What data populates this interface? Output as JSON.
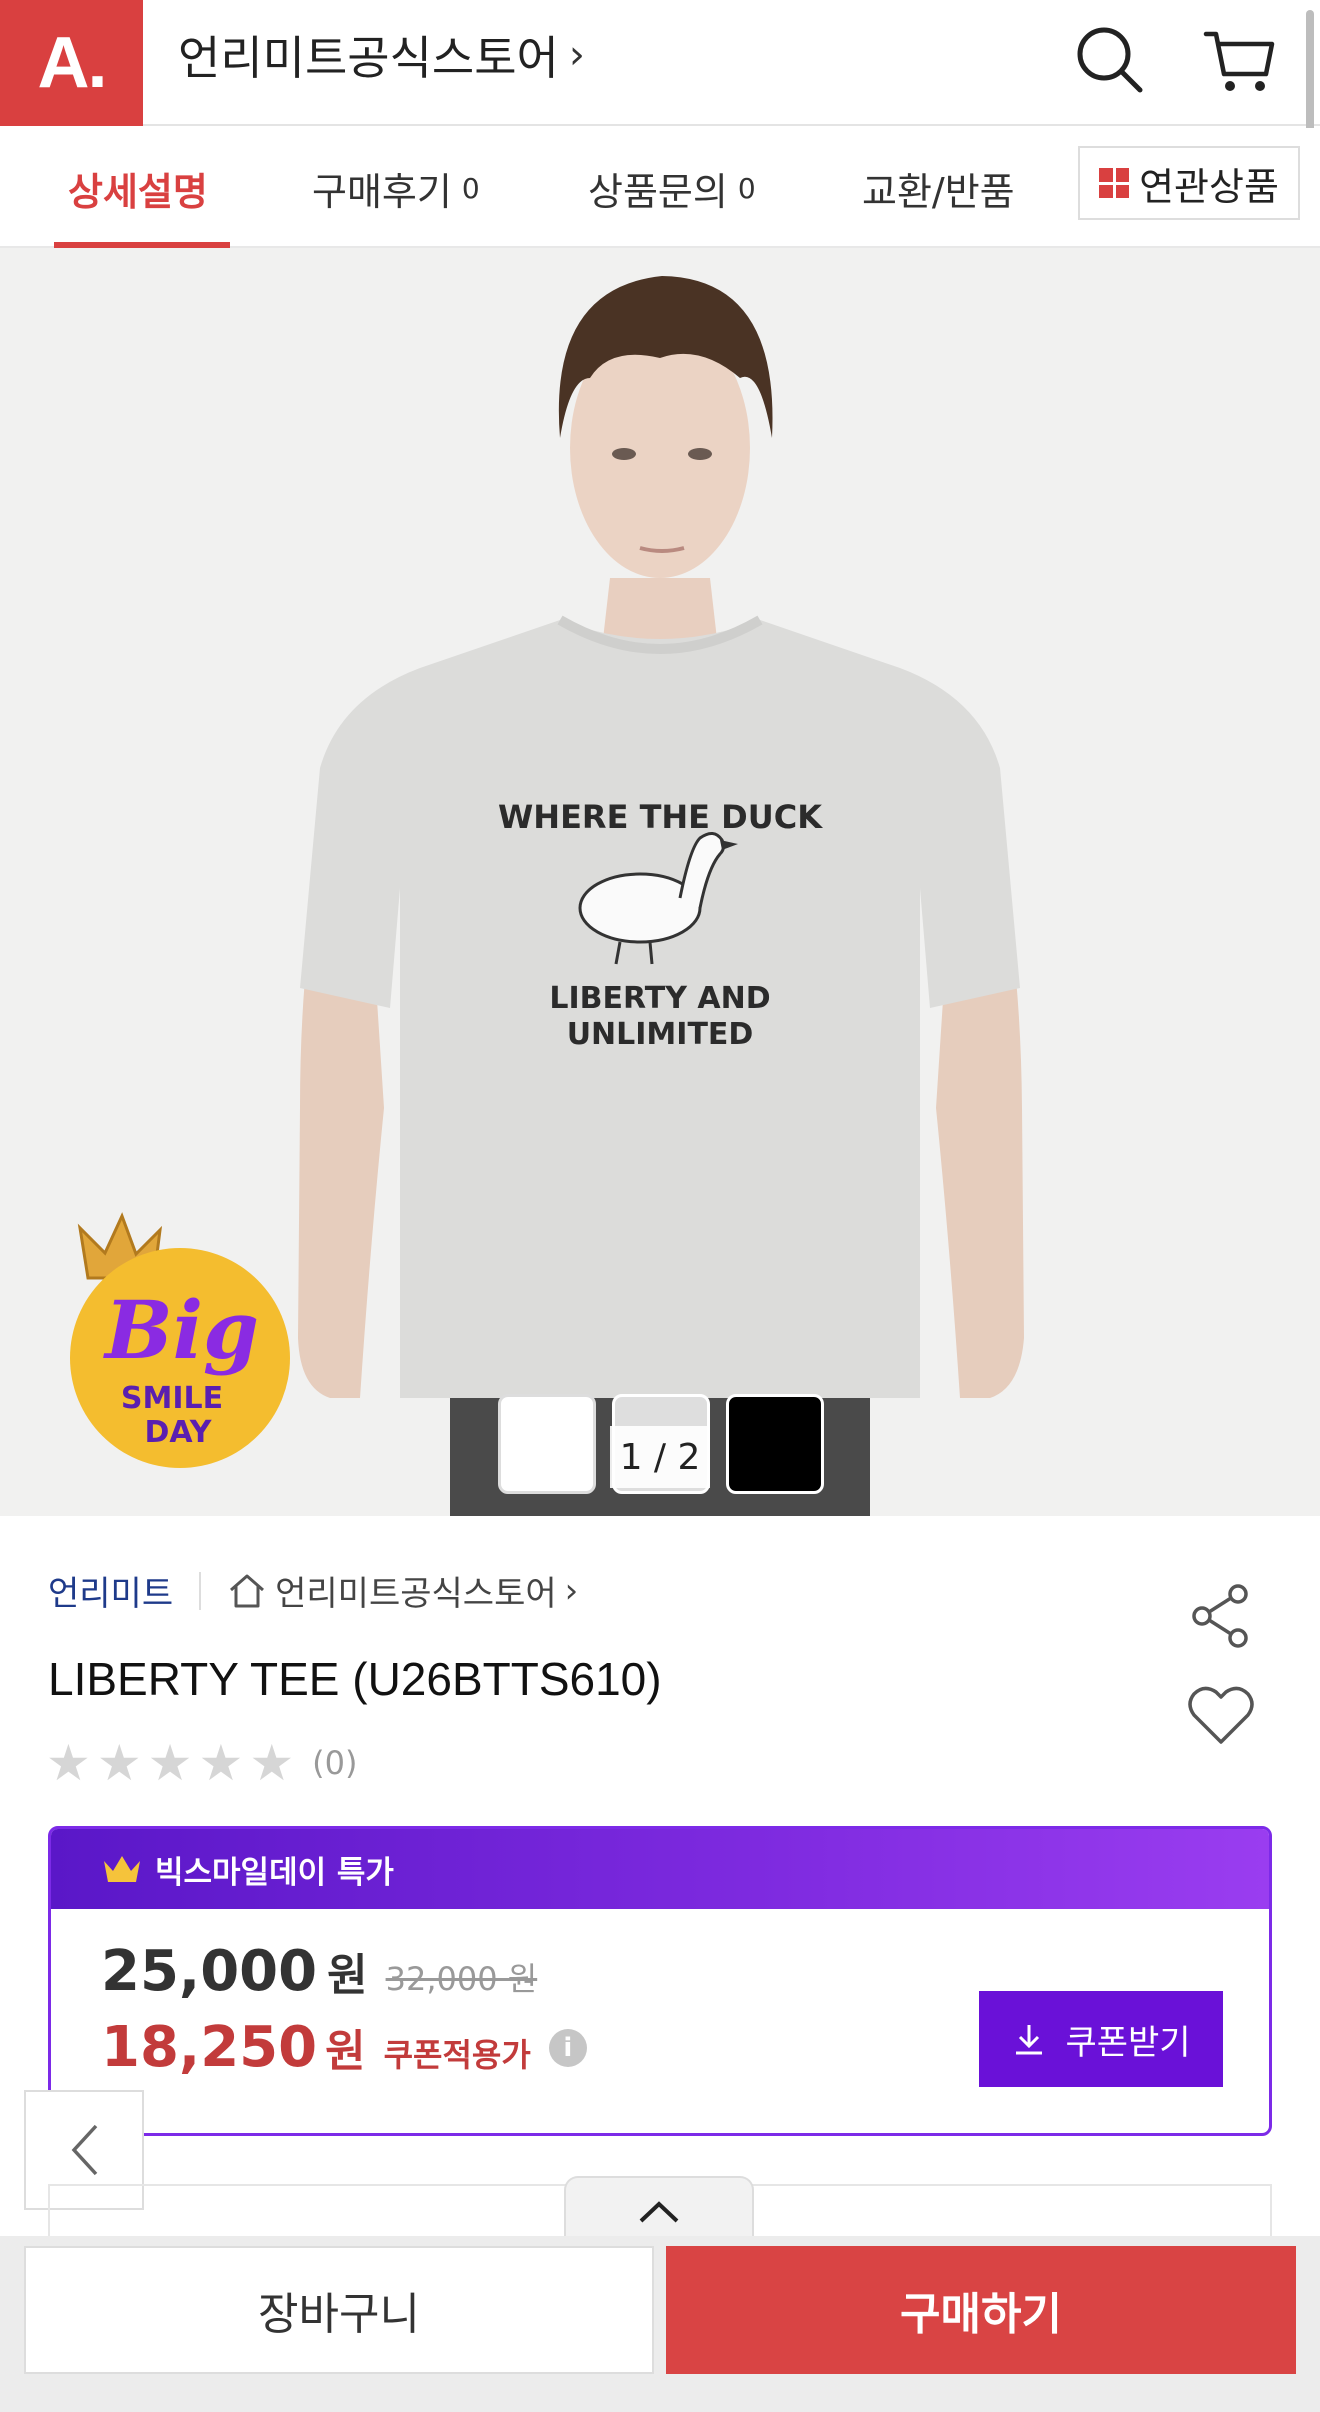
{
  "header": {
    "logo_text": "A.",
    "store_title": "언리미트공식스토어",
    "title_chevron": "›"
  },
  "tabs": [
    {
      "label": "상세설명",
      "count": ""
    },
    {
      "label": "구매후기",
      "count": "0"
    },
    {
      "label": "상품문의",
      "count": "0"
    },
    {
      "label": "교환/반품",
      "count": ""
    }
  ],
  "related_button": {
    "label": "연관상품"
  },
  "hero": {
    "page_indicator": "1 / 2",
    "shirt_print_top": "WHERE THE DUCK",
    "shirt_print_line1": "LIBERTY AND",
    "shirt_print_line2": "UNLIMITED",
    "badge_big": "Big",
    "badge_smile": "SMILE",
    "badge_day": "DAY",
    "thumbnails": [
      "white",
      "gray",
      "black"
    ]
  },
  "product": {
    "brand": "언리미트",
    "store_link": "언리미트공식스토어",
    "store_chevron": "›",
    "title": "LIBERTY TEE (U26BTTS610)",
    "rating_count": "(0)",
    "stars": 0
  },
  "promo": {
    "header": "빅스마일데이 특가",
    "price": "25,000",
    "price_unit": "원",
    "original_price": "32,000 원",
    "sale_price": "18,250",
    "sale_unit": "원",
    "sale_label": "쿠폰적용가",
    "info_glyph": "i",
    "coupon_button": "쿠폰받기"
  },
  "bottom": {
    "cart_button": "장바구니",
    "buy_button": "구매하기"
  },
  "colors": {
    "brand_red": "#d94040",
    "promo_purple": "#6a11d8",
    "sale_red": "#c23b3b"
  }
}
